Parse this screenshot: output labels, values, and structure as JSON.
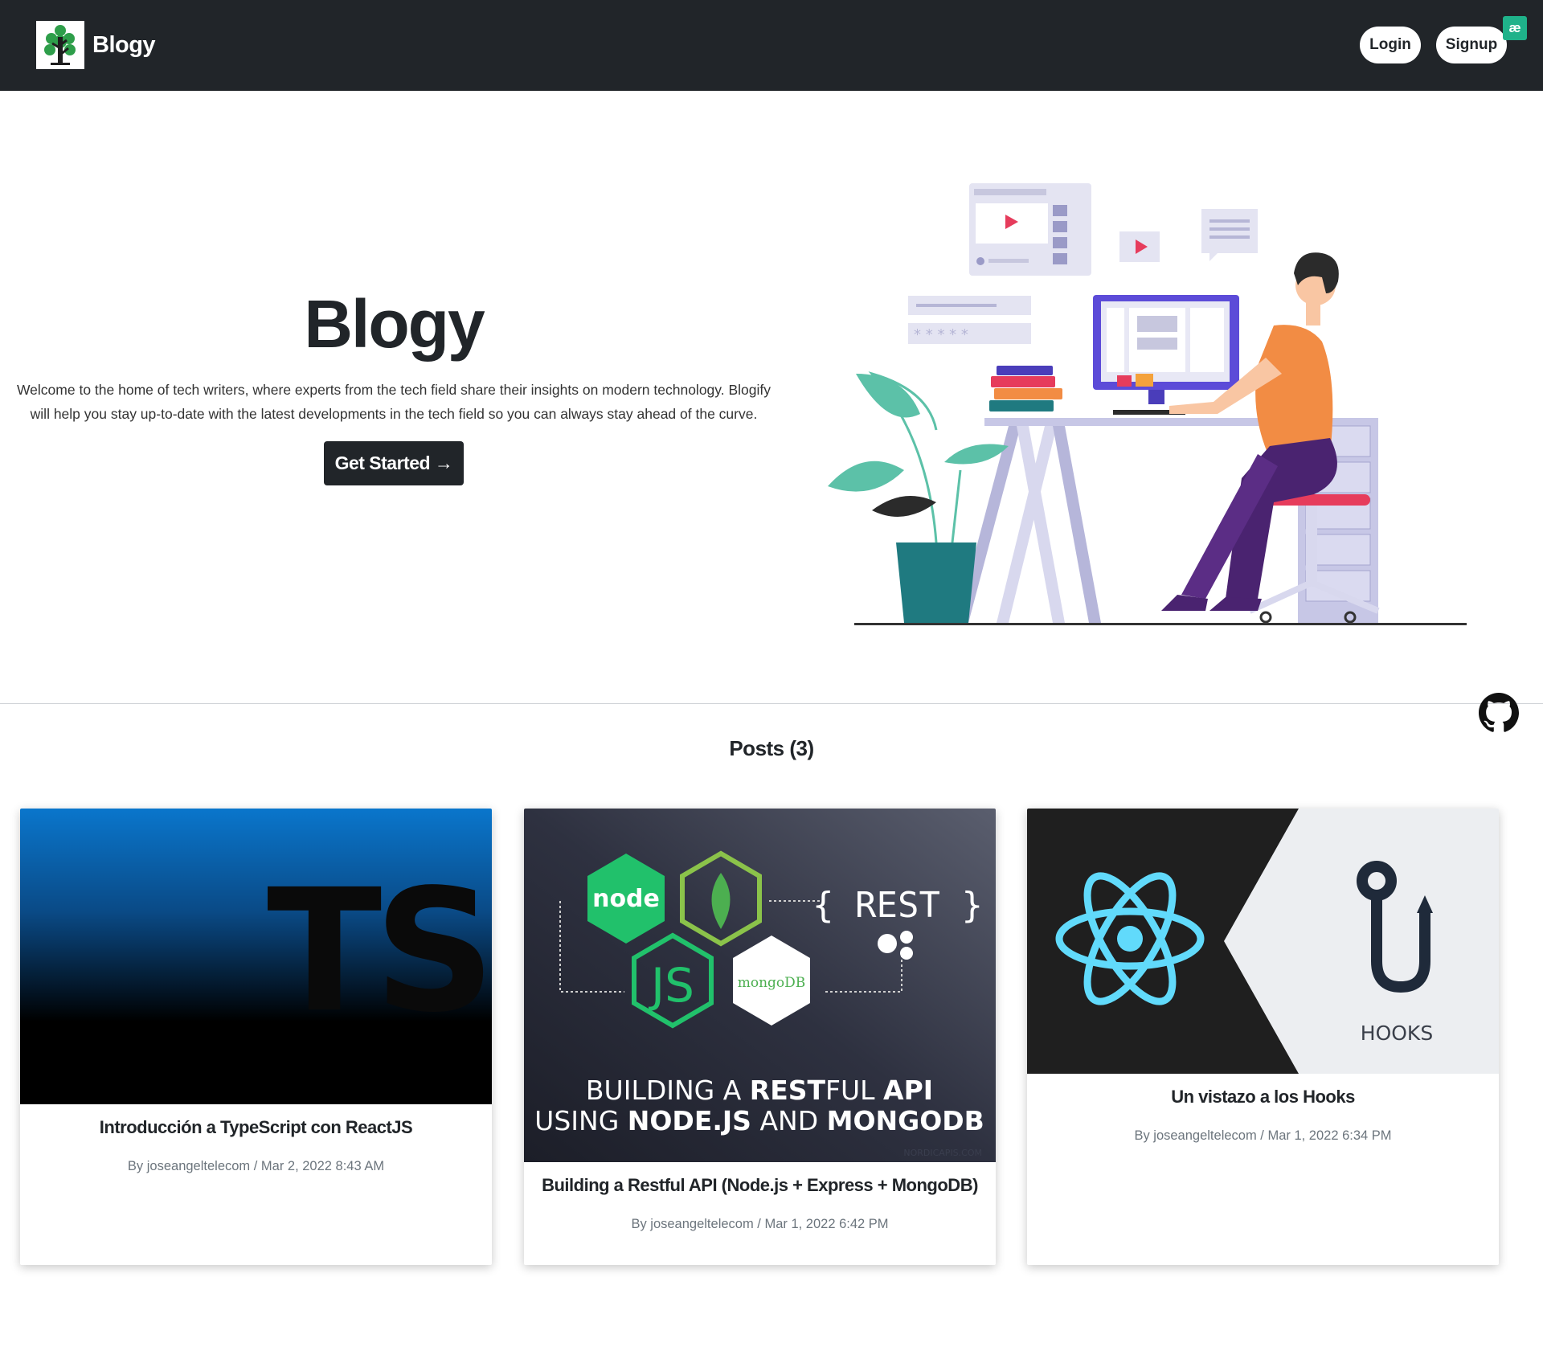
{
  "navbar": {
    "brand_name": "Blogy",
    "login_label": "Login",
    "signup_label": "Signup",
    "extension_badge": "æ"
  },
  "hero": {
    "title": "Blogy",
    "description": "Welcome to the home of tech writers, where experts from the tech field share their insights on modern technology. Blogify will help you stay up-to-date with the latest developments in the tech field so you can always stay ahead of the curve.",
    "cta_label": "Get Started →"
  },
  "posts": {
    "heading": "Posts (3)",
    "items": [
      {
        "title": "Introducción a TypeScript con ReactJS",
        "author_prefix": "By",
        "author": "joseangeltelecom",
        "date": "Mar 2, 2022 8:43 AM",
        "meta": "By joseangeltelecom / Mar 2, 2022 8:43 AM",
        "image_text": "TS"
      },
      {
        "title": "Building a Restful API (Node.js + Express + MongoDB)",
        "author": "joseangeltelecom",
        "date": "Mar 1, 2022 6:42 PM",
        "meta": "By joseangeltelecom / Mar 1, 2022 6:42 PM",
        "image_rest": "{ REST }",
        "image_line1_a": "BUILDING A ",
        "image_line1_b": "REST",
        "image_line1_c": "FUL ",
        "image_line1_d": "API",
        "image_line2_a": "USING ",
        "image_line2_b": "NODE.JS",
        "image_line2_c": " AND ",
        "image_line2_d": "MONGODB",
        "image_watermark": "NORDICAPIS.COM",
        "image_node": "node",
        "image_js": "JS",
        "image_mongo": "mongoDB"
      },
      {
        "title": "Un vistazo a los Hooks",
        "author": "joseangeltelecom",
        "date": "Mar 1, 2022 6:34 PM",
        "meta": "By joseangeltelecom / Mar 1, 2022 6:34 PM",
        "image_text": "HOOKS"
      }
    ]
  },
  "colors": {
    "navbar_bg": "#212529",
    "accent_orange": "#f28c44",
    "accent_purple": "#4a2370",
    "plant_green": "#5cc1a8",
    "react_blue": "#61dafb",
    "ts_blue": "#007acc",
    "node_green": "#21c16b"
  },
  "icons": [
    "tree-logo-icon",
    "github-icon",
    "arrow-right-icon",
    "react-atom-icon",
    "hook-icon"
  ]
}
